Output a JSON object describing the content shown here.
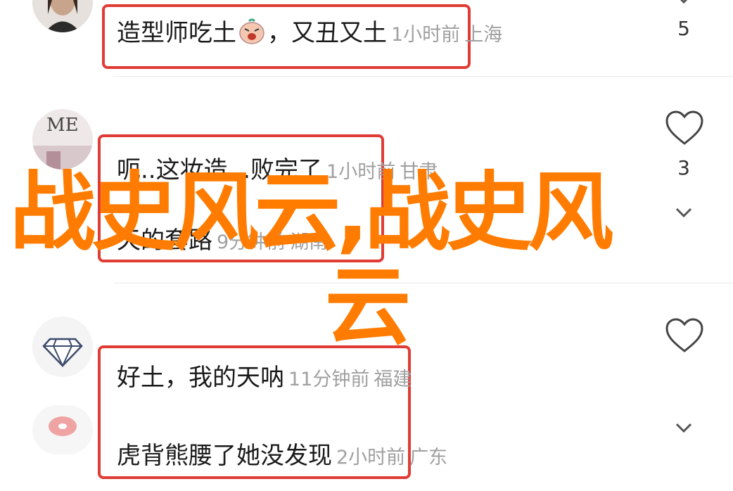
{
  "comments": [
    {
      "text": "造型师吃土",
      "text_after": "，又丑又土",
      "time": "1小时前",
      "location": "上海",
      "likes": "5"
    },
    {
      "text": "呃..这妆造...败完了",
      "time": "1小时前",
      "location": "甘肃",
      "likes": "3"
    },
    {
      "text": "天的套路",
      "time": "9分钟前",
      "location": "湖南"
    },
    {
      "text": "好土，我的天呐",
      "time": "11分钟前",
      "location": "福建"
    },
    {
      "text": "虎背熊腰了她没发现",
      "time": "2小时前",
      "location": "广东"
    }
  ],
  "avatar2_text": "ME",
  "overlay": {
    "line1": "战史风云,战史风",
    "line2": "云",
    "color": "#ff7c00"
  },
  "colors": {
    "highlight_border": "#e03c35",
    "meta_text": "#a0a0a0"
  }
}
